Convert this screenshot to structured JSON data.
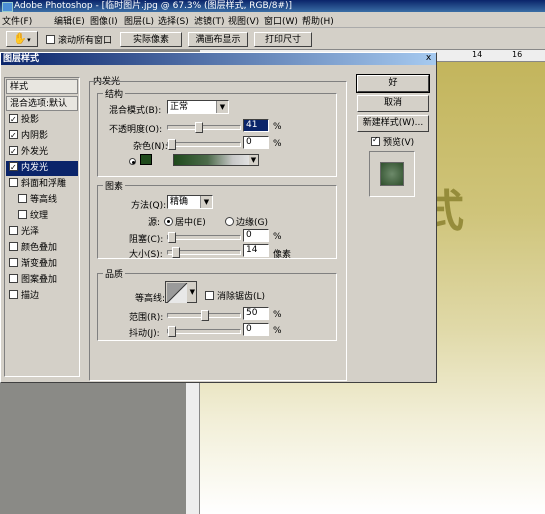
{
  "app": {
    "title": "Adobe Photoshop - [临时图片.jpg @ 67.3% (图层样式, RGB/8#)]"
  },
  "menubar": {
    "items": [
      "文件(F)",
      "编辑(E)",
      "图像(I)",
      "图层(L)",
      "选择(S)",
      "滤镜(T)",
      "视图(V)",
      "窗口(W)",
      "帮助(H)"
    ]
  },
  "toolbar": {
    "scroll_all": "滚动所有窗口",
    "actual_pixels": "实际像素",
    "fit_screen": "满画布显示",
    "print_size": "打印尺寸"
  },
  "ruler": {
    "mark1": "14",
    "mark2": "16"
  },
  "canvas": {
    "text": "式"
  },
  "dialog": {
    "title": "图层样式",
    "close": "x",
    "left_panel": {
      "styles": "样式",
      "blend_default": "混合选项:默认",
      "items": [
        {
          "label": "投影",
          "checked": true
        },
        {
          "label": "内阴影",
          "checked": true
        },
        {
          "label": "外发光",
          "checked": true
        },
        {
          "label": "内发光",
          "checked": true,
          "selected": true
        },
        {
          "label": "斜面和浮雕",
          "checked": false
        },
        {
          "label": "等高线",
          "checked": false,
          "indent": true
        },
        {
          "label": "纹理",
          "checked": false,
          "indent": true
        },
        {
          "label": "光泽",
          "checked": false
        },
        {
          "label": "颜色叠加",
          "checked": false
        },
        {
          "label": "渐变叠加",
          "checked": false
        },
        {
          "label": "图案叠加",
          "checked": false
        },
        {
          "label": "描边",
          "checked": false
        }
      ]
    },
    "inner_glow": {
      "section": "内发光",
      "structure": {
        "title": "结构",
        "blend_mode_label": "混合模式(B):",
        "blend_mode_value": "正常",
        "opacity_label": "不透明度(O):",
        "opacity_value": "41",
        "opacity_unit": "%",
        "opacity_level": 0.41,
        "noise_label": "杂色(N):",
        "noise_value": "0",
        "noise_unit": "%",
        "noise_level": 0,
        "glow_color": "#1f4a1c"
      },
      "elements": {
        "title": "图素",
        "method_label": "方法(Q):",
        "method_value": "精确",
        "source_label": "源:",
        "source_center": "居中(E)",
        "source_edge": "边缘(G)",
        "choke_label": "阻塞(C):",
        "choke_value": "0",
        "choke_unit": "%",
        "choke_level": 0,
        "size_label": "大小(S):",
        "size_value": "14",
        "size_unit": "像素",
        "size_level": 0.056
      },
      "quality": {
        "title": "品质",
        "contour_label": "等高线:",
        "antialias_label": "消除锯齿(L)",
        "range_label": "范围(R):",
        "range_value": "50",
        "range_unit": "%",
        "range_level": 0.5,
        "jitter_label": "抖动(J):",
        "jitter_value": "0",
        "jitter_unit": "%",
        "jitter_level": 0
      }
    },
    "buttons": {
      "ok": "好",
      "cancel": "取消",
      "new_style": "新建样式(W)...",
      "preview": "预览(V)"
    }
  }
}
